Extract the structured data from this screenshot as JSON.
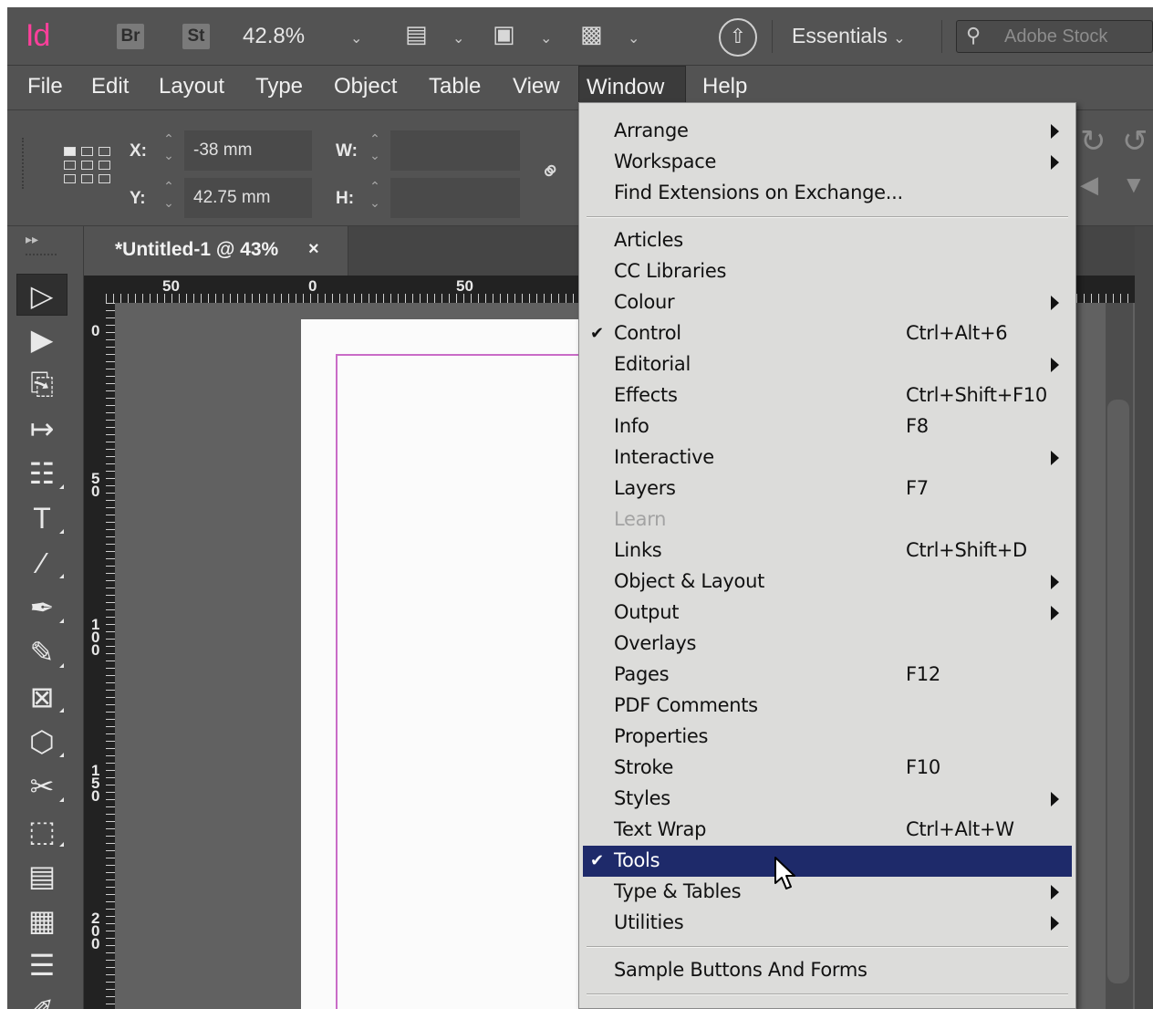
{
  "app": {
    "logo": "Id",
    "bridge_badge": "Br",
    "stock_badge": "St",
    "zoom_level": "42.8%",
    "workspace_label": "Essentials",
    "search_placeholder": "Adobe Stock"
  },
  "menubar": {
    "items": [
      "File",
      "Edit",
      "Layout",
      "Type",
      "Object",
      "Table",
      "View",
      "Window",
      "Help"
    ],
    "active": "Window"
  },
  "control_panel": {
    "x_label": "X:",
    "x_value": "-38 mm",
    "y_label": "Y:",
    "y_value": "42.75 mm",
    "w_label": "W:",
    "w_value": "",
    "h_label": "H:",
    "h_value": ""
  },
  "document": {
    "tab_title": "*Untitled-1 @ 43%",
    "close_glyph": "×",
    "h_ruler_labels": [
      "50",
      "0",
      "50"
    ],
    "v_ruler_labels": [
      "0",
      "50",
      "100",
      "150",
      "200"
    ]
  },
  "window_menu": {
    "items": [
      {
        "label": "Arrange",
        "shortcut": "",
        "submenu": true,
        "checked": false,
        "disabled": false
      },
      {
        "label": "Workspace",
        "shortcut": "",
        "submenu": true,
        "checked": false,
        "disabled": false
      },
      {
        "label": "Find Extensions on Exchange...",
        "shortcut": "",
        "submenu": false,
        "checked": false,
        "disabled": false
      },
      {
        "separator": true
      },
      {
        "label": "Articles",
        "shortcut": "",
        "submenu": false,
        "checked": false,
        "disabled": false
      },
      {
        "label": "CC Libraries",
        "shortcut": "",
        "submenu": false,
        "checked": false,
        "disabled": false
      },
      {
        "label": "Colour",
        "shortcut": "",
        "submenu": true,
        "checked": false,
        "disabled": false
      },
      {
        "label": "Control",
        "shortcut": "Ctrl+Alt+6",
        "submenu": false,
        "checked": true,
        "disabled": false
      },
      {
        "label": "Editorial",
        "shortcut": "",
        "submenu": true,
        "checked": false,
        "disabled": false
      },
      {
        "label": "Effects",
        "shortcut": "Ctrl+Shift+F10",
        "submenu": false,
        "checked": false,
        "disabled": false
      },
      {
        "label": "Info",
        "shortcut": "F8",
        "submenu": false,
        "checked": false,
        "disabled": false
      },
      {
        "label": "Interactive",
        "shortcut": "",
        "submenu": true,
        "checked": false,
        "disabled": false
      },
      {
        "label": "Layers",
        "shortcut": "F7",
        "submenu": false,
        "checked": false,
        "disabled": false
      },
      {
        "label": "Learn",
        "shortcut": "",
        "submenu": false,
        "checked": false,
        "disabled": true
      },
      {
        "label": "Links",
        "shortcut": "Ctrl+Shift+D",
        "submenu": false,
        "checked": false,
        "disabled": false
      },
      {
        "label": "Object & Layout",
        "shortcut": "",
        "submenu": true,
        "checked": false,
        "disabled": false
      },
      {
        "label": "Output",
        "shortcut": "",
        "submenu": true,
        "checked": false,
        "disabled": false
      },
      {
        "label": "Overlays",
        "shortcut": "",
        "submenu": false,
        "checked": false,
        "disabled": false
      },
      {
        "label": "Pages",
        "shortcut": "F12",
        "submenu": false,
        "checked": false,
        "disabled": false
      },
      {
        "label": "PDF Comments",
        "shortcut": "",
        "submenu": false,
        "checked": false,
        "disabled": false
      },
      {
        "label": "Properties",
        "shortcut": "",
        "submenu": false,
        "checked": false,
        "disabled": false
      },
      {
        "label": "Stroke",
        "shortcut": "F10",
        "submenu": false,
        "checked": false,
        "disabled": false
      },
      {
        "label": "Styles",
        "shortcut": "",
        "submenu": true,
        "checked": false,
        "disabled": false
      },
      {
        "label": "Text Wrap",
        "shortcut": "Ctrl+Alt+W",
        "submenu": false,
        "checked": false,
        "disabled": false
      },
      {
        "label": "Tools",
        "shortcut": "",
        "submenu": false,
        "checked": true,
        "disabled": false,
        "highlighted": true
      },
      {
        "label": "Type & Tables",
        "shortcut": "",
        "submenu": true,
        "checked": false,
        "disabled": false
      },
      {
        "label": "Utilities",
        "shortcut": "",
        "submenu": true,
        "checked": false,
        "disabled": false
      },
      {
        "separator": true
      },
      {
        "label": "Sample Buttons And Forms",
        "shortcut": "",
        "submenu": false,
        "checked": false,
        "disabled": false
      },
      {
        "separator": true
      }
    ]
  },
  "tools": [
    {
      "name": "selection-tool-icon",
      "glyph": "▷",
      "selected": true
    },
    {
      "name": "direct-selection-tool-icon",
      "glyph": "▶",
      "selected": false
    },
    {
      "name": "page-tool-icon",
      "glyph": "⎘",
      "selected": false
    },
    {
      "name": "gap-tool-icon",
      "glyph": "↦",
      "selected": false
    },
    {
      "name": "content-collector-tool-icon",
      "glyph": "☷",
      "selected": false
    },
    {
      "name": "type-tool-icon",
      "glyph": "T",
      "selected": false
    },
    {
      "name": "line-tool-icon",
      "glyph": "∕",
      "selected": false
    },
    {
      "name": "pen-tool-icon",
      "glyph": "✒",
      "selected": false
    },
    {
      "name": "pencil-tool-icon",
      "glyph": "✎",
      "selected": false
    },
    {
      "name": "rectangle-frame-tool-icon",
      "glyph": "⊠",
      "selected": false
    },
    {
      "name": "polygon-tool-icon",
      "glyph": "⬡",
      "selected": false
    },
    {
      "name": "scissors-tool-icon",
      "glyph": "✂",
      "selected": false
    },
    {
      "name": "free-transform-tool-icon",
      "glyph": "⬚",
      "selected": false
    },
    {
      "name": "gradient-swatch-tool-icon",
      "glyph": "▤",
      "selected": false
    },
    {
      "name": "gradient-feather-tool-icon",
      "glyph": "▦",
      "selected": false
    },
    {
      "name": "note-tool-icon",
      "glyph": "☰",
      "selected": false
    },
    {
      "name": "eyedropper-tool-icon",
      "glyph": "✐",
      "selected": false
    }
  ],
  "colors": {
    "menu_highlight": "#1e2a6a",
    "logo_pink": "#ff3f9b",
    "margin_guide": "#c96cc7"
  }
}
